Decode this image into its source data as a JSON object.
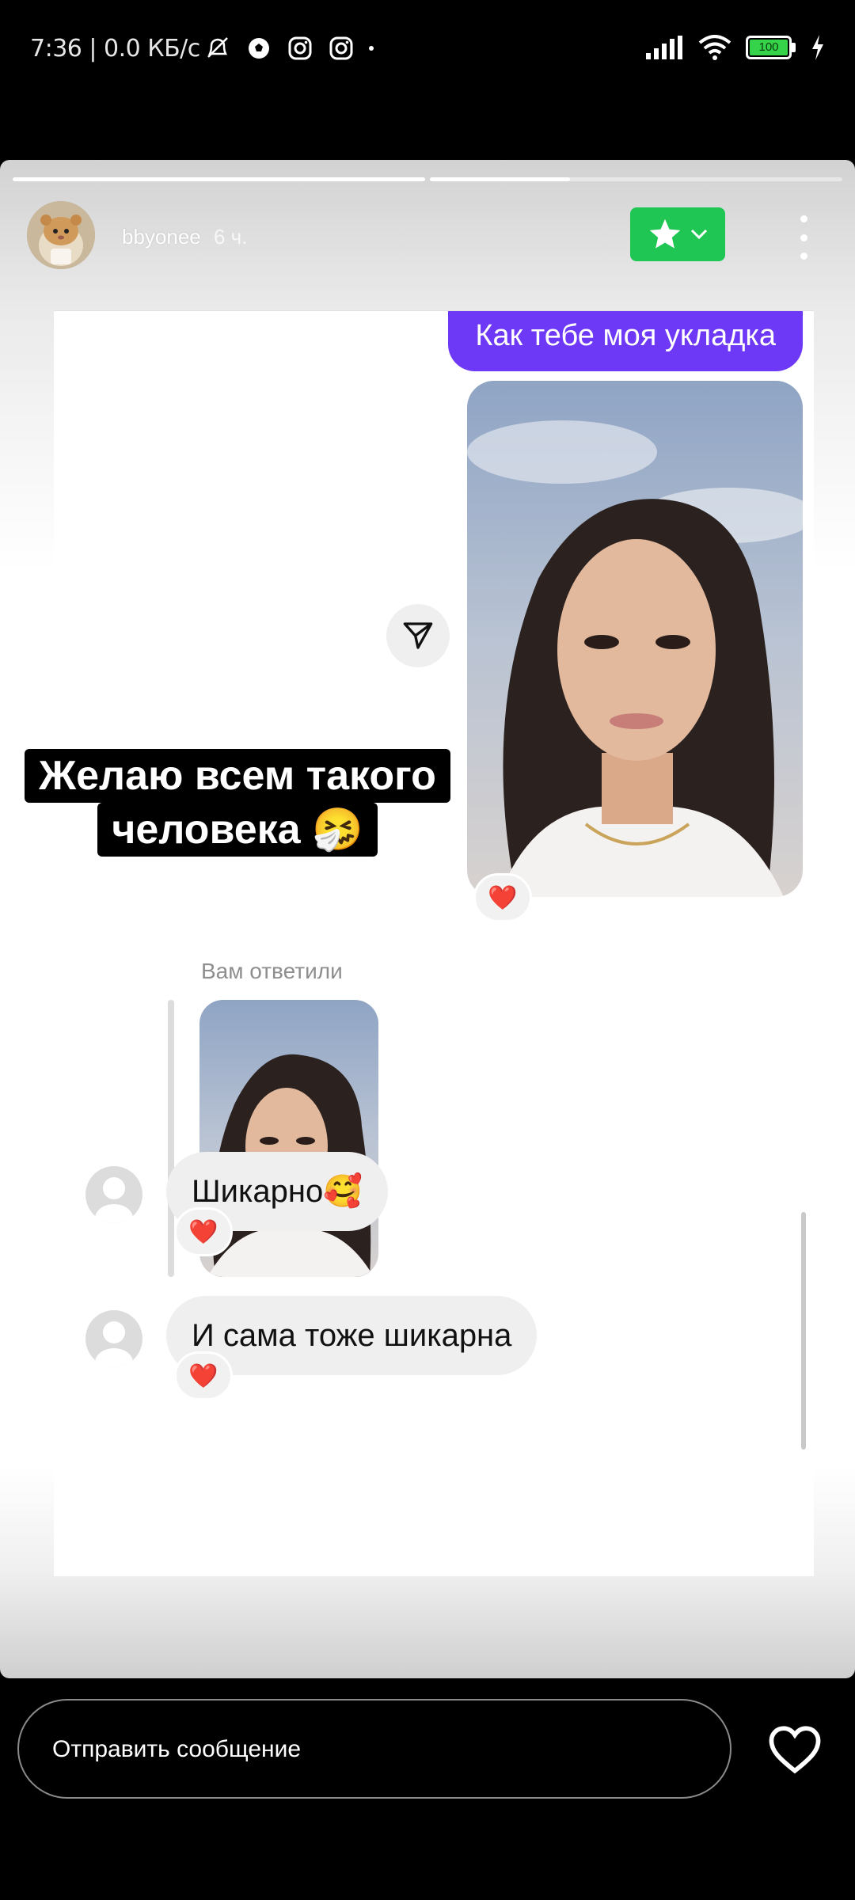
{
  "status_bar": {
    "time_speed": "7:36 | 0.0 КБ/с",
    "battery": "100",
    "icons": [
      "silent-alarm-icon",
      "soccer-ball-icon",
      "instagram-icon",
      "instagram-icon",
      "dot-icon",
      "signal-icon",
      "wifi-icon",
      "battery-icon",
      "charging-icon"
    ]
  },
  "story": {
    "username": "bbyonee",
    "time_ago": "6 ч.",
    "favorite_button_icon": "star-icon",
    "progress": [
      1.0,
      0.34
    ],
    "accent_color": "#1fc653"
  },
  "chat": {
    "outgoing_message": "Как тебе моя укладка",
    "outgoing_color": "#6d38f6",
    "reaction": "❤️",
    "replied_label": "Вам ответили",
    "incoming": [
      {
        "text": "Шикарно🥰",
        "reaction": "❤️"
      },
      {
        "text": "И сама тоже шикарна",
        "reaction": "❤️"
      }
    ]
  },
  "overlay": {
    "line1": "Желаю всем такого",
    "line2": "человека 🤧"
  },
  "bottom": {
    "message_placeholder": "Отправить сообщение",
    "like_icon": "heart-outline-icon"
  }
}
